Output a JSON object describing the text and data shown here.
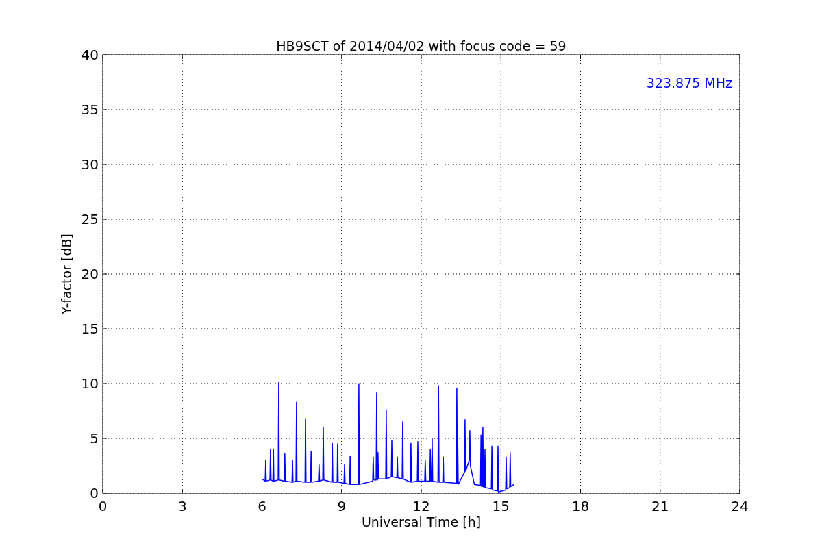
{
  "figure": {
    "chart_data": {
      "type": "line",
      "title": "HB9SCT of 2014/04/02 with focus code = 59",
      "xlabel": "Universal Time [h]",
      "ylabel": "Y-factor [dB]",
      "xlim": [
        0,
        24
      ],
      "ylim": [
        0,
        40
      ],
      "xticks": [
        0,
        3,
        6,
        9,
        12,
        15,
        18,
        21,
        24
      ],
      "yticks": [
        0,
        5,
        10,
        15,
        20,
        25,
        30,
        35,
        40
      ],
      "grid": true,
      "x": [
        6.0,
        6.12,
        6.14,
        6.16,
        6.3,
        6.32,
        6.34,
        6.41,
        6.43,
        6.45,
        6.61,
        6.63,
        6.65,
        6.84,
        6.86,
        6.88,
        7.13,
        7.15,
        7.17,
        7.28,
        7.3,
        7.32,
        7.62,
        7.64,
        7.66,
        7.83,
        7.85,
        7.87,
        8.13,
        8.15,
        8.17,
        8.29,
        8.31,
        8.33,
        8.63,
        8.65,
        8.67,
        8.83,
        8.85,
        8.87,
        9.09,
        9.11,
        9.13,
        9.3,
        9.32,
        9.34,
        9.63,
        9.65,
        9.67,
        10.17,
        10.19,
        10.21,
        10.3,
        10.32,
        10.34,
        10.35,
        10.37,
        10.39,
        10.66,
        10.68,
        10.7,
        10.87,
        10.89,
        10.91,
        11.08,
        11.1,
        11.12,
        11.28,
        11.3,
        11.32,
        11.59,
        11.61,
        11.63,
        11.85,
        11.87,
        11.89,
        12.13,
        12.15,
        12.17,
        12.32,
        12.34,
        12.36,
        12.39,
        12.41,
        12.43,
        12.63,
        12.65,
        12.67,
        12.81,
        12.83,
        12.85,
        13.32,
        13.34,
        13.36,
        13.37,
        13.39,
        13.63,
        13.65,
        13.67,
        13.81,
        13.83,
        13.85,
        14.0,
        14.23,
        14.25,
        14.27,
        14.3,
        14.32,
        14.34,
        14.38,
        14.4,
        14.42,
        14.64,
        14.66,
        14.68,
        14.87,
        14.89,
        14.91,
        15.18,
        15.2,
        15.22,
        15.33,
        15.35,
        15.37,
        15.5
      ],
      "series": [
        {
          "name": "323.875 MHz",
          "color": "#0000ff",
          "values": [
            1.3,
            1.1,
            3.0,
            1.1,
            1.2,
            4.0,
            1.2,
            1.1,
            4.0,
            1.1,
            1.2,
            10.1,
            1.2,
            1.1,
            3.6,
            1.1,
            1.0,
            3.0,
            1.0,
            1.1,
            8.3,
            1.1,
            1.0,
            6.8,
            1.0,
            1.0,
            3.8,
            1.0,
            1.1,
            2.6,
            1.1,
            1.2,
            6.0,
            1.2,
            1.0,
            4.6,
            1.0,
            1.0,
            4.5,
            1.0,
            0.9,
            2.6,
            0.9,
            0.8,
            3.4,
            0.8,
            0.8,
            10.0,
            0.8,
            1.1,
            3.3,
            1.2,
            1.2,
            9.2,
            1.2,
            1.2,
            3.7,
            1.3,
            1.3,
            7.6,
            1.3,
            1.5,
            4.8,
            1.5,
            1.4,
            3.3,
            1.4,
            1.3,
            6.5,
            1.3,
            1.0,
            4.6,
            1.0,
            1.1,
            4.7,
            1.1,
            1.1,
            3.0,
            1.1,
            1.1,
            4.0,
            1.1,
            1.1,
            5.0,
            1.1,
            1.0,
            9.8,
            1.0,
            1.0,
            3.3,
            1.0,
            0.9,
            9.6,
            0.9,
            5.6,
            0.8,
            1.9,
            6.7,
            2.0,
            3.0,
            5.7,
            2.5,
            0.8,
            0.7,
            5.3,
            0.6,
            0.6,
            6.0,
            0.6,
            0.5,
            4.0,
            0.5,
            0.4,
            4.3,
            0.3,
            0.2,
            4.3,
            0.1,
            0.3,
            3.3,
            0.4,
            0.5,
            3.7,
            0.6,
            0.8
          ]
        }
      ]
    }
  }
}
